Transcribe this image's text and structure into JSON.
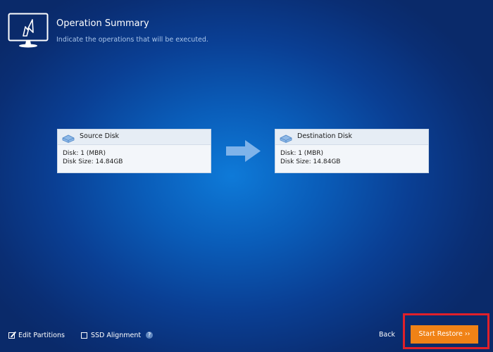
{
  "header": {
    "title": "Operation Summary",
    "subtitle": "Indicate the operations that will be executed.",
    "icon": "monitor-restore-icon"
  },
  "source_disk": {
    "title": "Source Disk",
    "icon": "disk-icon",
    "disk_line": "Disk: 1 (MBR)",
    "size_line": "Disk Size: 14.84GB"
  },
  "destination_disk": {
    "title": "Destination Disk",
    "icon": "disk-icon",
    "disk_line": "Disk: 1 (MBR)",
    "size_line": "Disk Size: 14.84GB"
  },
  "transfer_arrow": {
    "icon": "arrow-right-icon"
  },
  "options": {
    "edit_partitions": {
      "label": "Edit Partitions",
      "icon": "edit-checkbox-icon"
    },
    "ssd_alignment": {
      "label": "SSD Alignment",
      "checked": false,
      "help_icon": "help-icon"
    }
  },
  "actions": {
    "back_label": "Back",
    "start_label": "Start Restore ››"
  },
  "colors": {
    "background_center": "#0e7ad8",
    "background_edge": "#0a2a6a",
    "accent_button": "#f08216",
    "highlight_frame": "#e0202a",
    "card_background": "#f3f6fa"
  }
}
